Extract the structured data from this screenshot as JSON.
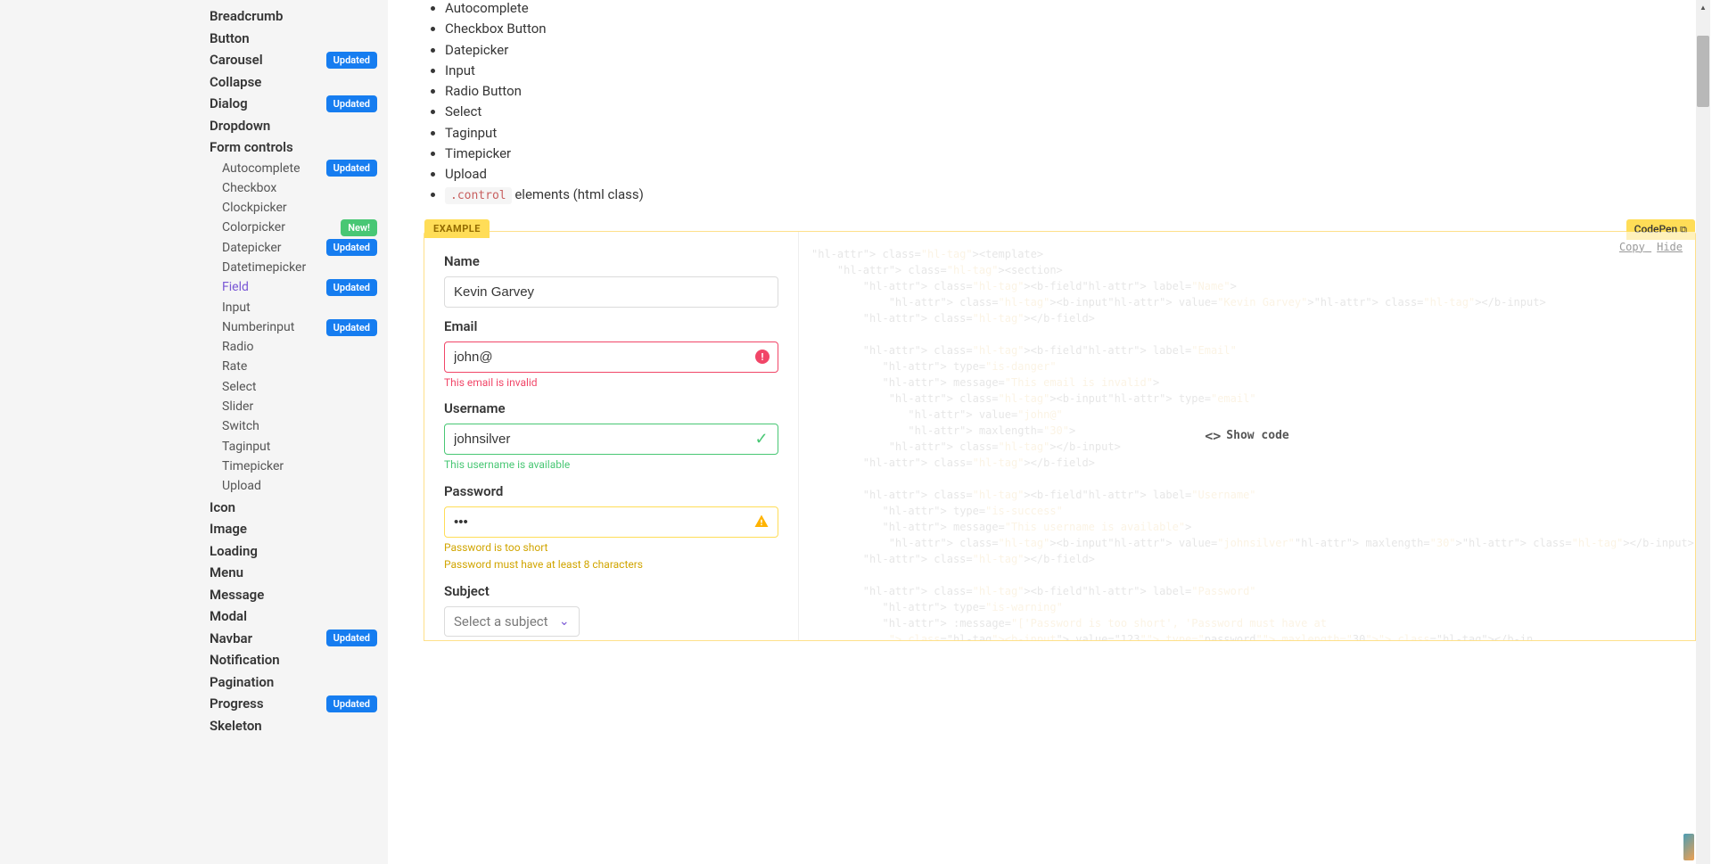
{
  "sidebar": {
    "items": [
      {
        "label": "Breadcrumb",
        "badge": null
      },
      {
        "label": "Button",
        "badge": null
      },
      {
        "label": "Carousel",
        "badge": "Updated"
      },
      {
        "label": "Collapse",
        "badge": null
      },
      {
        "label": "Dialog",
        "badge": "Updated"
      },
      {
        "label": "Dropdown",
        "badge": null
      },
      {
        "label": "Form controls",
        "badge": null
      }
    ],
    "subitems": [
      {
        "label": "Autocomplete",
        "badge": "Updated",
        "active": false
      },
      {
        "label": "Checkbox",
        "badge": null,
        "active": false
      },
      {
        "label": "Clockpicker",
        "badge": null,
        "active": false
      },
      {
        "label": "Colorpicker",
        "badge": "New!",
        "badgeColor": "green",
        "active": false
      },
      {
        "label": "Datepicker",
        "badge": "Updated",
        "active": false
      },
      {
        "label": "Datetimepicker",
        "badge": null,
        "active": false
      },
      {
        "label": "Field",
        "badge": "Updated",
        "active": true
      },
      {
        "label": "Input",
        "badge": null,
        "active": false
      },
      {
        "label": "Numberinput",
        "badge": "Updated",
        "active": false
      },
      {
        "label": "Radio",
        "badge": null,
        "active": false
      },
      {
        "label": "Rate",
        "badge": null,
        "active": false
      },
      {
        "label": "Select",
        "badge": null,
        "active": false
      },
      {
        "label": "Slider",
        "badge": null,
        "active": false
      },
      {
        "label": "Switch",
        "badge": null,
        "active": false
      },
      {
        "label": "Taginput",
        "badge": null,
        "active": false
      },
      {
        "label": "Timepicker",
        "badge": null,
        "active": false
      },
      {
        "label": "Upload",
        "badge": null,
        "active": false
      }
    ],
    "items2": [
      {
        "label": "Icon",
        "badge": null
      },
      {
        "label": "Image",
        "badge": null
      },
      {
        "label": "Loading",
        "badge": null
      },
      {
        "label": "Menu",
        "badge": null
      },
      {
        "label": "Message",
        "badge": null
      },
      {
        "label": "Modal",
        "badge": null
      },
      {
        "label": "Navbar",
        "badge": "Updated"
      },
      {
        "label": "Notification",
        "badge": null
      },
      {
        "label": "Pagination",
        "badge": null
      },
      {
        "label": "Progress",
        "badge": "Updated"
      },
      {
        "label": "Skeleton",
        "badge": null
      }
    ]
  },
  "top_list": [
    "Autocomplete",
    "Checkbox Button",
    "Datepicker",
    "Input",
    "Radio Button",
    "Select",
    "Taginput",
    "Timepicker",
    "Upload"
  ],
  "control_code": ".control",
  "control_suffix": " elements (html class)",
  "example_label": "EXAMPLE",
  "codepen_label": "CodePen",
  "show_code_label": "Show code",
  "code_actions": {
    "copy": "Copy",
    "hide": "Hide"
  },
  "form": {
    "name_label": "Name",
    "name_value": "Kevin Garvey",
    "email_label": "Email",
    "email_value": "john@",
    "email_help": "This email is invalid",
    "username_label": "Username",
    "username_value": "johnsilver",
    "username_help": "This username is available",
    "password_label": "Password",
    "password_value": "•••",
    "password_help1": "Password is too short",
    "password_help2": "Password must have at least 8 characters",
    "subject_label": "Subject",
    "subject_placeholder": "Select a subject"
  },
  "code_sample": "<template>\n    <section>\n        <b-field label=\"Name\">\n            <b-input value=\"Kevin Garvey\"></b-input>\n        </b-field>\n\n        <b-field label=\"Email\"\n            type=\"is-danger\"\n            message=\"This email is invalid\">\n            <b-input type=\"email\"\n                value=\"john@\"\n                maxlength=\"30\">\n            </b-input>\n        </b-field>\n\n        <b-field label=\"Username\"\n            type=\"is-success\"\n            message=\"This username is available\">\n            <b-input value=\"johnsilver\" maxlength=\"30\"></b-input>\n        </b-field>\n\n        <b-field label=\"Password\"\n            type=\"is-warning\"\n            :message=\"['Password is too short', 'Password must have at\n            <b-input value=\"123\" type=\"password\" maxlength=\"30\"></b-in"
}
